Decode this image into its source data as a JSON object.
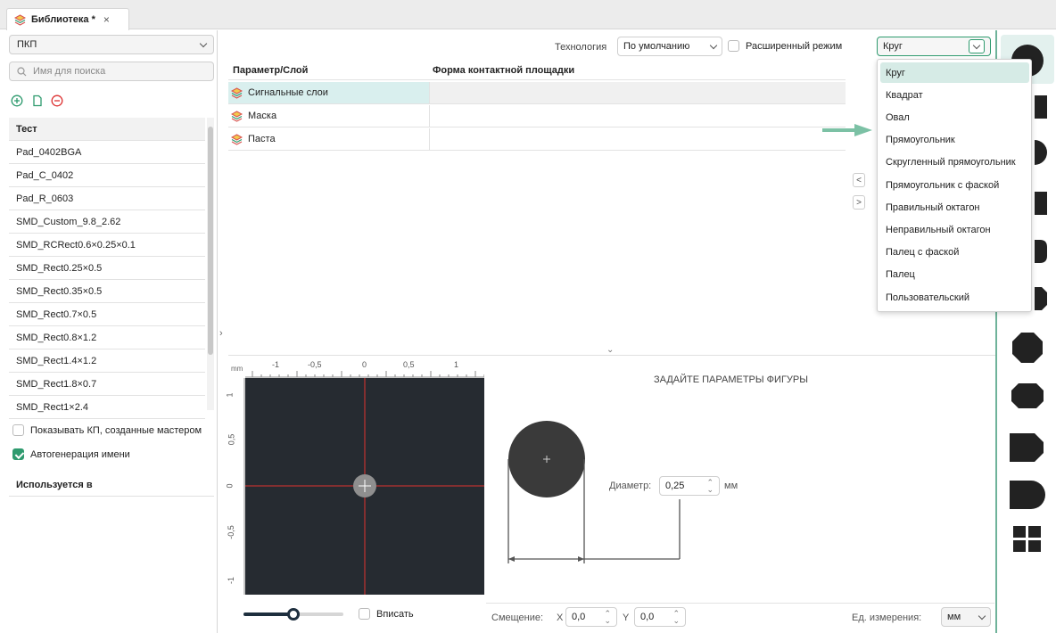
{
  "tab": {
    "title": "Библиотека *",
    "close": "×"
  },
  "left": {
    "library_select": "ПКП",
    "search_placeholder": "Имя для поиска",
    "list_header": "Тест",
    "items": [
      "Pad_0402BGA",
      "Pad_C_0402",
      "Pad_R_0603",
      "SMD_Custom_9.8_2.62",
      "SMD_RCRect0.6×0.25×0.1",
      "SMD_Rect0.25×0.5",
      "SMD_Rect0.35×0.5",
      "SMD_Rect0.7×0.5",
      "SMD_Rect0.8×1.2",
      "SMD_Rect1.4×1.2",
      "SMD_Rect1.8×0.7",
      "SMD_Rect1×2.4"
    ],
    "show_wizard_label": "Показывать КП, созданные мастером",
    "show_wizard_checked": false,
    "autoname_label": "Автогенерация имени",
    "autoname_checked": true,
    "used_in": "Используется в"
  },
  "toolbar": {
    "technology_label": "Технология",
    "technology_value": "По умолчанию",
    "advanced_label": "Расширенный режим",
    "advanced_checked": false,
    "shape_value": "Круг"
  },
  "table": {
    "col1": "Параметр/Слой",
    "col2": "Форма контактной площадки",
    "rows": [
      "Сигнальные слои",
      "Маска",
      "Паста"
    ]
  },
  "shape_menu": [
    "Круг",
    "Квадрат",
    "Овал",
    "Прямоугольник",
    "Скругленный прямоугольник",
    "Прямоугольник с фаской",
    "Правильный октагон",
    "Неправильный октагон",
    "Палец с фаской",
    "Палец",
    "Пользовательский"
  ],
  "preview": {
    "unit": "mm",
    "xticks": [
      "-1",
      "-0,5",
      "0",
      "0,5",
      "1"
    ],
    "yticks": [
      "1",
      "0,5",
      "0",
      "-0,5",
      "-1"
    ],
    "fit_label": "Вписать",
    "zoom_level": 0.5
  },
  "params": {
    "title": "ЗАДАЙТЕ ПАРАМЕТРЫ ФИГУРЫ",
    "diameter_label": "Диаметр:",
    "diameter_value": "0,25",
    "diameter_unit": "мм"
  },
  "bottom": {
    "offset_label": "Смещение:",
    "x_label": "X",
    "x_value": "0,0",
    "y_label": "Y",
    "y_value": "0,0",
    "units_label": "Ед. измерения:",
    "units_value": "мм"
  },
  "colors": {
    "accent": "#2e9a6e",
    "canvas": "#262b31",
    "selection": "#d6ebe6"
  }
}
